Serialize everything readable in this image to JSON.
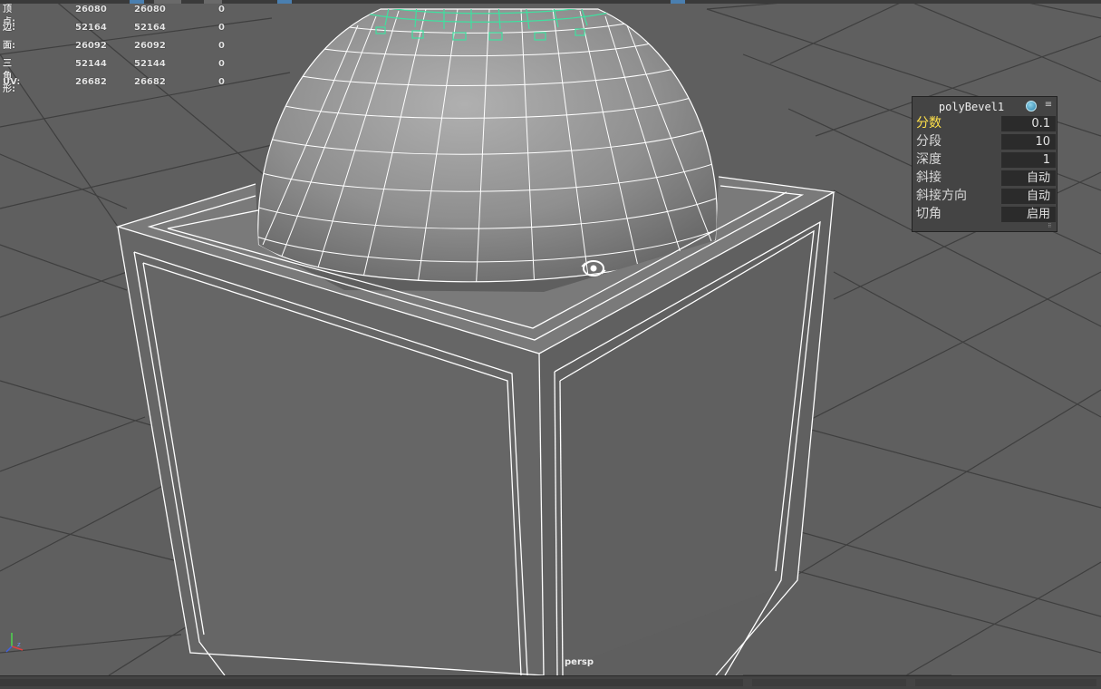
{
  "hud": {
    "rows": [
      {
        "label": "顶点:",
        "v1": "26080",
        "v2": "26080",
        "v3": "0"
      },
      {
        "label": "边:",
        "v1": "52164",
        "v2": "52164",
        "v3": "0"
      },
      {
        "label": "面:",
        "v1": "26092",
        "v2": "26092",
        "v3": "0"
      },
      {
        "label": "三角形:",
        "v1": "52144",
        "v2": "52144",
        "v3": "0"
      },
      {
        "label": "UV:",
        "v1": "26682",
        "v2": "26682",
        "v3": "0"
      }
    ]
  },
  "channel_box": {
    "title": "polyBevel1",
    "rows": [
      {
        "label": "分数",
        "value": "0.1"
      },
      {
        "label": "分段",
        "value": "10"
      },
      {
        "label": "深度",
        "value": "1"
      },
      {
        "label": "斜接",
        "value": "自动"
      },
      {
        "label": "斜接方向",
        "value": "自动"
      },
      {
        "label": "切角",
        "value": "启用"
      }
    ]
  },
  "viewport": {
    "camera": "persp"
  },
  "colors": {
    "viewport_bg": "#5f5f5f",
    "grid": "#3f3f3f",
    "wire": "#ffffff",
    "selected_wire": "#3fe0a0",
    "highlight_label": "#ffe14a"
  },
  "icons": [
    "view-cube-gizmo-icon",
    "axis-indicator-icon",
    "channel-box-menu-icon",
    "channel-box-ball-icon"
  ]
}
